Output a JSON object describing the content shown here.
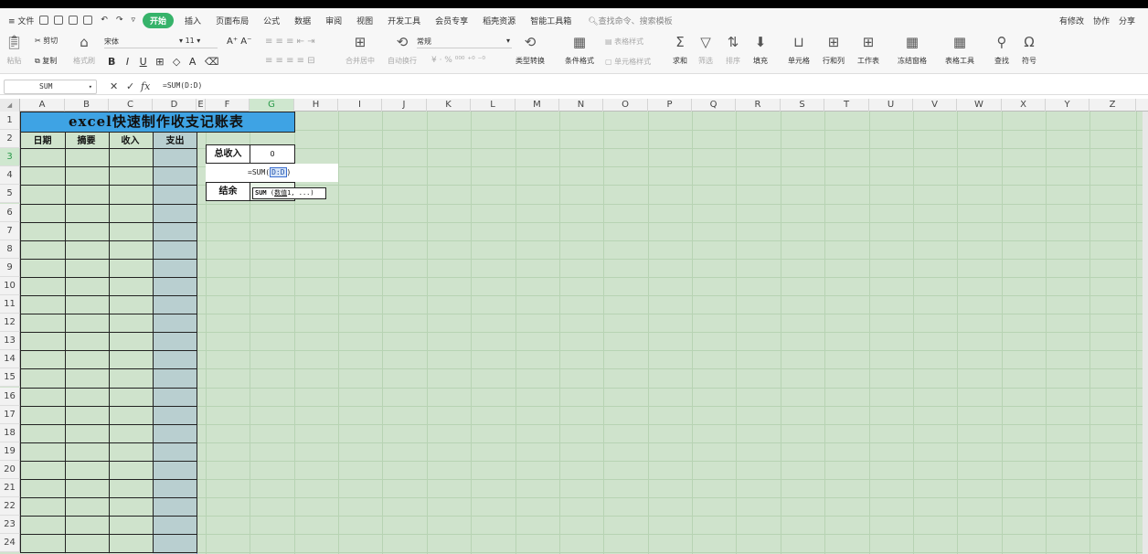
{
  "menubar": {
    "file": "≡ 文件",
    "tabs": [
      "开始",
      "插入",
      "页面布局",
      "公式",
      "数据",
      "审阅",
      "视图",
      "开发工具",
      "会员专享",
      "稻壳资源",
      "智能工具箱"
    ],
    "search": "查找命令、搜索模板",
    "right": [
      "有修改",
      "协作",
      "分享"
    ]
  },
  "ribbon": {
    "paste": "粘贴",
    "cut": "剪切",
    "copy": "复制",
    "format_painter": "格式刷",
    "font_name": "宋体",
    "font_size": "11",
    "merge": "合并居中",
    "wrap": "自动换行",
    "number_format": "常规",
    "convert": "类型转换",
    "conditional": "条件格式",
    "table_style": "表格样式",
    "cell_style": "单元格样式",
    "sum": "求和",
    "filter": "筛选",
    "sort": "排序",
    "fill": "填充",
    "cell": "单元格",
    "rowcol": "行和列",
    "sheet": "工作表",
    "freeze": "冻结窗格",
    "table_tools": "表格工具",
    "find": "查找",
    "symbol": "符号"
  },
  "formula_bar": {
    "name_box": "SUM",
    "formula": "=SUM(D:D)"
  },
  "grid": {
    "columns": [
      "A",
      "B",
      "C",
      "D",
      "E",
      "F",
      "G",
      "H",
      "I",
      "J",
      "K",
      "L",
      "M",
      "N",
      "O",
      "P",
      "Q",
      "R",
      "S",
      "T",
      "U",
      "V",
      "W",
      "X",
      "Y",
      "Z"
    ],
    "rows": [
      "1",
      "2",
      "3",
      "4",
      "5",
      "6",
      "7",
      "8",
      "9",
      "10",
      "11",
      "12",
      "13",
      "14",
      "15",
      "16",
      "17",
      "18",
      "19",
      "20",
      "21",
      "22",
      "23",
      "24"
    ]
  },
  "sheet": {
    "title": "excel快速制作收支记账表",
    "headers": [
      "日期",
      "摘要",
      "收入",
      "支出"
    ],
    "summary": {
      "total_income_label": "总收入",
      "total_income_value": "0",
      "balance_label": "结余"
    },
    "editing": {
      "prefix": "=SUM(",
      "ref": "D:D",
      "suffix": ")"
    },
    "tooltip": {
      "fn": "SUM",
      "arg_open": " (",
      "arg_current": "数值",
      "arg_rest": "1, ...)"
    }
  },
  "colors": {
    "accent_green": "#36b36a",
    "title_bg": "#3ea3e4",
    "sheet_bg": "#cfe3cc",
    "column_d": "#b9cfd0"
  }
}
